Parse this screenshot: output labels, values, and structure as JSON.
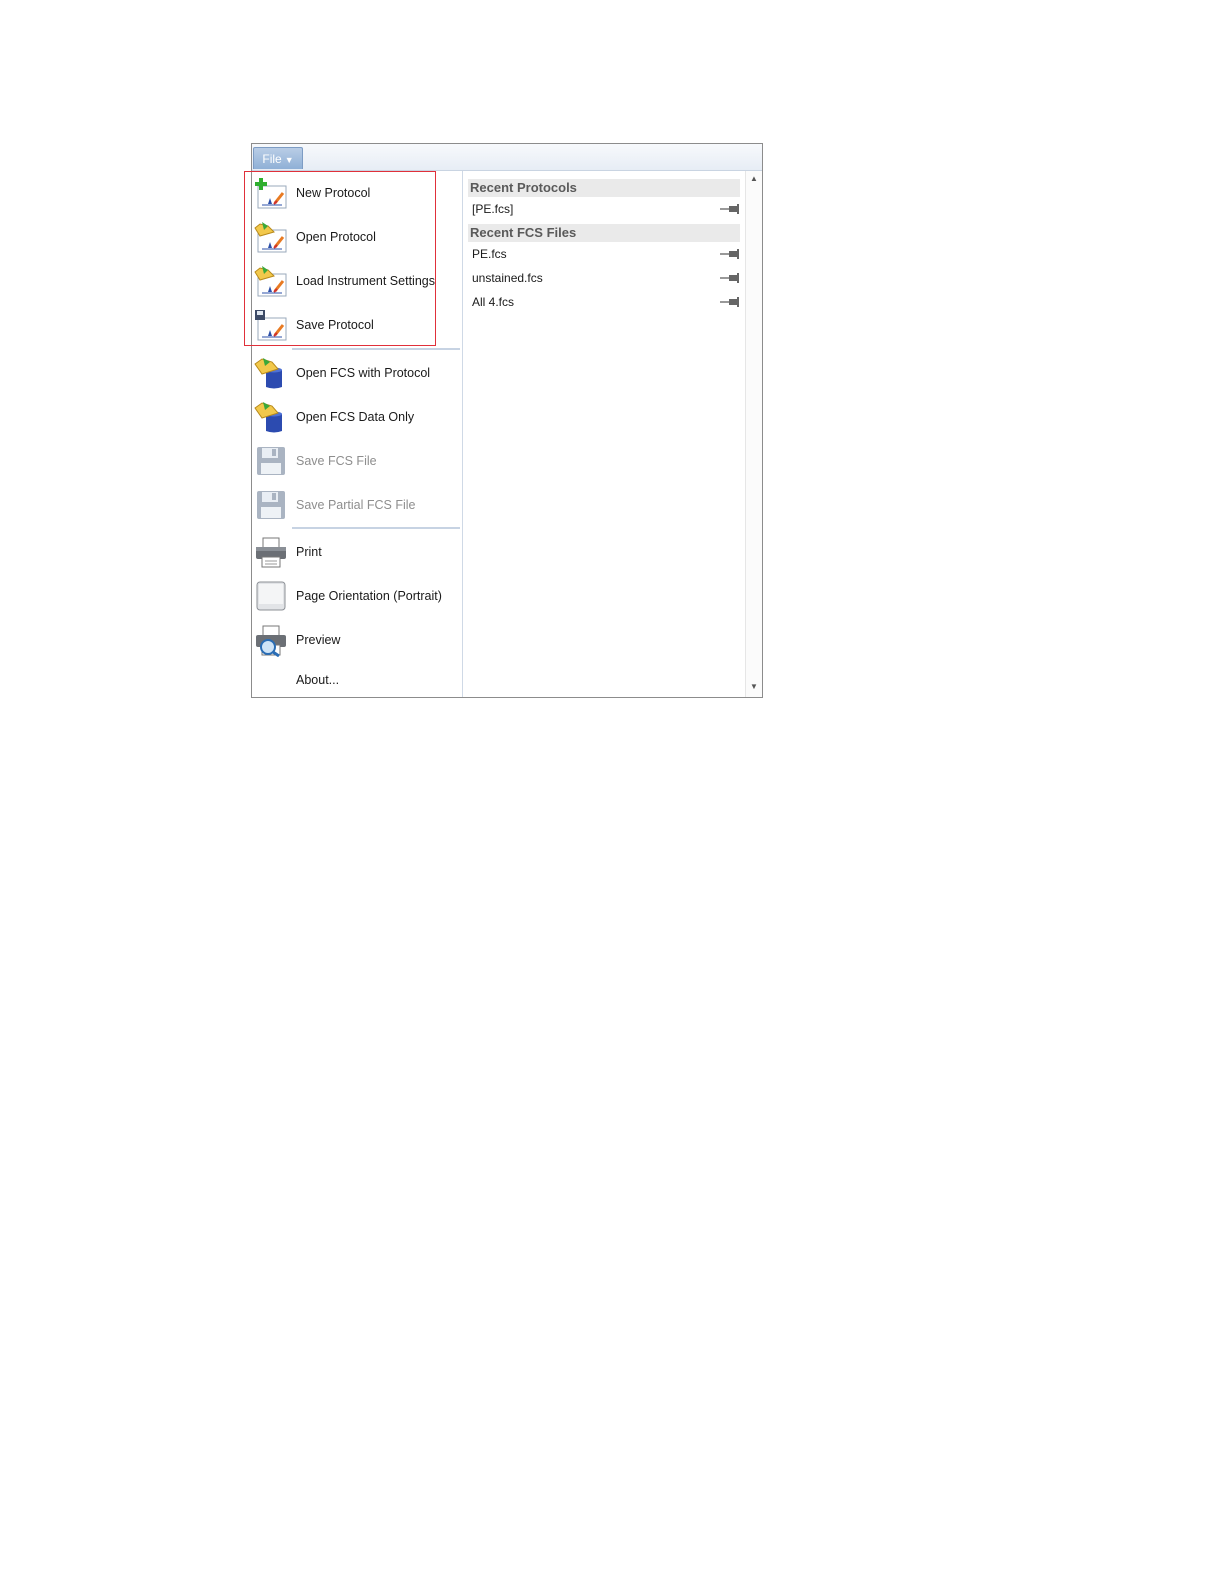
{
  "menubar": {
    "file_label": "File"
  },
  "menu_items": [
    {
      "label": "New Protocol",
      "icon": "new-protocol-icon",
      "disabled": false
    },
    {
      "label": "Open Protocol",
      "icon": "open-protocol-icon",
      "disabled": false
    },
    {
      "label": "Load Instrument Settings",
      "icon": "load-settings-icon",
      "disabled": false
    },
    {
      "label": "Save Protocol",
      "icon": "save-protocol-icon",
      "disabled": false
    },
    {
      "label": "Open FCS with Protocol",
      "icon": "open-fcs-protocol-icon",
      "disabled": false
    },
    {
      "label": "Open FCS Data Only",
      "icon": "open-fcs-data-icon",
      "disabled": false
    },
    {
      "label": "Save FCS File",
      "icon": "floppy-icon",
      "disabled": true
    },
    {
      "label": "Save Partial FCS File",
      "icon": "floppy-icon",
      "disabled": true
    },
    {
      "label": "Print",
      "icon": "printer-icon",
      "disabled": false
    },
    {
      "label": "Page Orientation (Portrait)",
      "icon": "page-icon",
      "disabled": false
    },
    {
      "label": "Preview",
      "icon": "preview-icon",
      "disabled": false
    },
    {
      "label": "About...",
      "icon": "",
      "disabled": false
    }
  ],
  "recent_protocols": {
    "title": "Recent Protocols",
    "items": [
      "[PE.fcs]"
    ]
  },
  "recent_fcs": {
    "title": "Recent FCS Files",
    "items": [
      "PE.fcs",
      "unstained.fcs",
      "All 4.fcs"
    ]
  },
  "colors": {
    "highlight": "#e0303a",
    "accent": "#8fb0d6"
  }
}
